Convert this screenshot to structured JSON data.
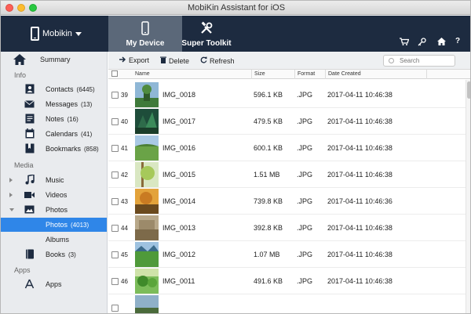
{
  "window": {
    "title": "MobiKin Assistant for iOS"
  },
  "header": {
    "device_name": "Mobikin",
    "tabs": [
      {
        "label": "My Device"
      },
      {
        "label": "Super Toolkit"
      }
    ],
    "icons": [
      "cart-icon",
      "key-icon",
      "home-icon",
      "help-icon"
    ],
    "help_glyph": "?"
  },
  "sidebar": {
    "summary": "Summary",
    "sections": {
      "info": "Info",
      "media": "Media",
      "apps": "Apps"
    },
    "info_items": [
      {
        "label": "Contacts",
        "count": "(6445)",
        "icon": "contacts-icon"
      },
      {
        "label": "Messages",
        "count": "(13)",
        "icon": "messages-icon"
      },
      {
        "label": "Notes",
        "count": "(16)",
        "icon": "notes-icon"
      },
      {
        "label": "Calendars",
        "count": "(41)",
        "icon": "calendar-icon"
      },
      {
        "label": "Bookmarks",
        "count": "(858)",
        "icon": "bookmarks-icon"
      }
    ],
    "media_items": [
      {
        "label": "Music",
        "icon": "music-icon"
      },
      {
        "label": "Videos",
        "icon": "video-icon"
      },
      {
        "label": "Photos",
        "icon": "photos-icon"
      }
    ],
    "photos_sub": {
      "label": "Photos",
      "count": "(4013)"
    },
    "albums": "Albums",
    "books": {
      "label": "Books",
      "count": "(3)"
    },
    "apps_item": "Apps"
  },
  "toolbar": {
    "export": "Export",
    "delete": "Delete",
    "refresh": "Refresh",
    "search_placeholder": "Search"
  },
  "table": {
    "columns": [
      "Name",
      "Size",
      "Format",
      "Date Created"
    ],
    "rows": [
      {
        "num": "39",
        "name": "IMG_0018",
        "size": "596.1 KB",
        "format": ".JPG",
        "date": "2017-04-11 10:46:38"
      },
      {
        "num": "40",
        "name": "IMG_0017",
        "size": "479.5 KB",
        "format": ".JPG",
        "date": "2017-04-11 10:46:38"
      },
      {
        "num": "41",
        "name": "IMG_0016",
        "size": "600.1 KB",
        "format": ".JPG",
        "date": "2017-04-11 10:46:38"
      },
      {
        "num": "42",
        "name": "IMG_0015",
        "size": "1.51 MB",
        "format": ".JPG",
        "date": "2017-04-11 10:46:38"
      },
      {
        "num": "43",
        "name": "IMG_0014",
        "size": "739.8 KB",
        "format": ".JPG",
        "date": "2017-04-11 10:46:36"
      },
      {
        "num": "44",
        "name": "IMG_0013",
        "size": "392.8 KB",
        "format": ".JPG",
        "date": "2017-04-11 10:46:38"
      },
      {
        "num": "45",
        "name": "IMG_0012",
        "size": "1.07 MB",
        "format": ".JPG",
        "date": "2017-04-11 10:46:38"
      },
      {
        "num": "46",
        "name": "IMG_0011",
        "size": "491.6 KB",
        "format": ".JPG",
        "date": "2017-04-11 10:46:38"
      },
      {
        "num": "",
        "name": "",
        "size": "",
        "format": "",
        "date": ""
      }
    ]
  },
  "colors": {
    "header_bg": "#1d2b40",
    "active_tab": "#5b6879",
    "selection": "#2f86e8",
    "sidebar_bg": "#e9ebee"
  }
}
